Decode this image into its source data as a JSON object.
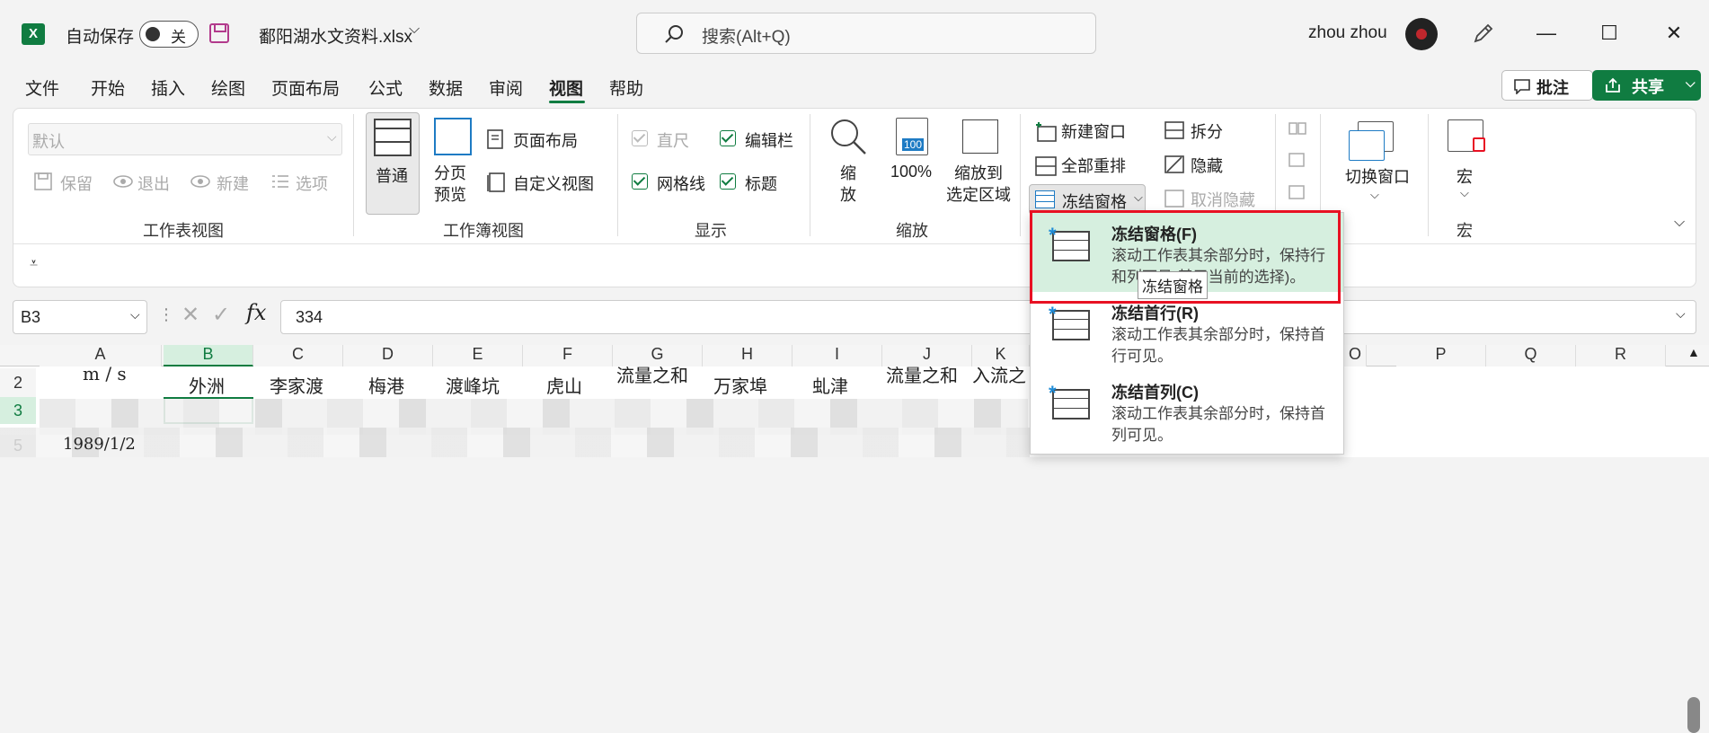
{
  "titlebar": {
    "autosave_label": "自动保存",
    "autosave_state": "关",
    "filename": "鄱阳湖水文资料.xlsx",
    "search_placeholder": "搜索(Alt+Q)",
    "user_name": "zhou zhou"
  },
  "tabs": [
    "文件",
    "开始",
    "插入",
    "绘图",
    "页面布局",
    "公式",
    "数据",
    "审阅",
    "视图",
    "帮助"
  ],
  "active_tab": "视图",
  "actions": {
    "comment": "批注",
    "share": "共享"
  },
  "ribbon": {
    "sheet_view": {
      "dropdown_value": "默认",
      "keep": "保留",
      "exit": "退出",
      "new": "新建",
      "options": "选项",
      "group_label": "工作表视图"
    },
    "workbook_view": {
      "normal": "普通",
      "page_break": "分页\n预览",
      "page_layout": "页面布局",
      "custom_view": "自定义视图",
      "group_label": "工作簿视图"
    },
    "show": {
      "ruler": "直尺",
      "formula_bar": "编辑栏",
      "gridlines": "网格线",
      "headings": "标题",
      "group_label": "显示"
    },
    "zoom": {
      "zoom": "缩\n放",
      "zoom_100_icon_text": "100",
      "hundred": "100%",
      "zoom_selection": "缩放到\n选定区域",
      "group_label": "缩放"
    },
    "window": {
      "new_window": "新建窗口",
      "arrange_all": "全部重排",
      "freeze_panes": "冻结窗格",
      "split": "拆分",
      "hide": "隐藏",
      "unhide": "取消隐藏",
      "switch_windows": "切换窗口"
    },
    "macros": {
      "macros": "宏",
      "group_label": "宏"
    }
  },
  "formula_bar": {
    "name_box": "B3",
    "formula": "334"
  },
  "sheet": {
    "columns": [
      "A",
      "B",
      "C",
      "D",
      "E",
      "F",
      "G",
      "H",
      "I",
      "J",
      "K",
      "O",
      "P",
      "Q",
      "R"
    ],
    "row_numbers": [
      "2",
      "3",
      "5"
    ],
    "row2": [
      "m / s",
      "外洲",
      "李家渡",
      "梅港",
      "渡峰坑",
      "虎山",
      "流量之和",
      "万家埠",
      "虬津",
      "流量之和",
      "入流之"
    ],
    "row5_a": "1989/1/2"
  },
  "freeze_menu": {
    "items": [
      {
        "title": "冻结窗格(F)",
        "desc": "滚动工作表其余部分时，保持行和列可见(基于当前的选择)。"
      },
      {
        "title": "冻结首行(R)",
        "desc": "滚动工作表其余部分时，保持首行可见。"
      },
      {
        "title": "冻结首列(C)",
        "desc": "滚动工作表其余部分时，保持首列可见。"
      }
    ],
    "tooltip": "冻结窗格"
  }
}
